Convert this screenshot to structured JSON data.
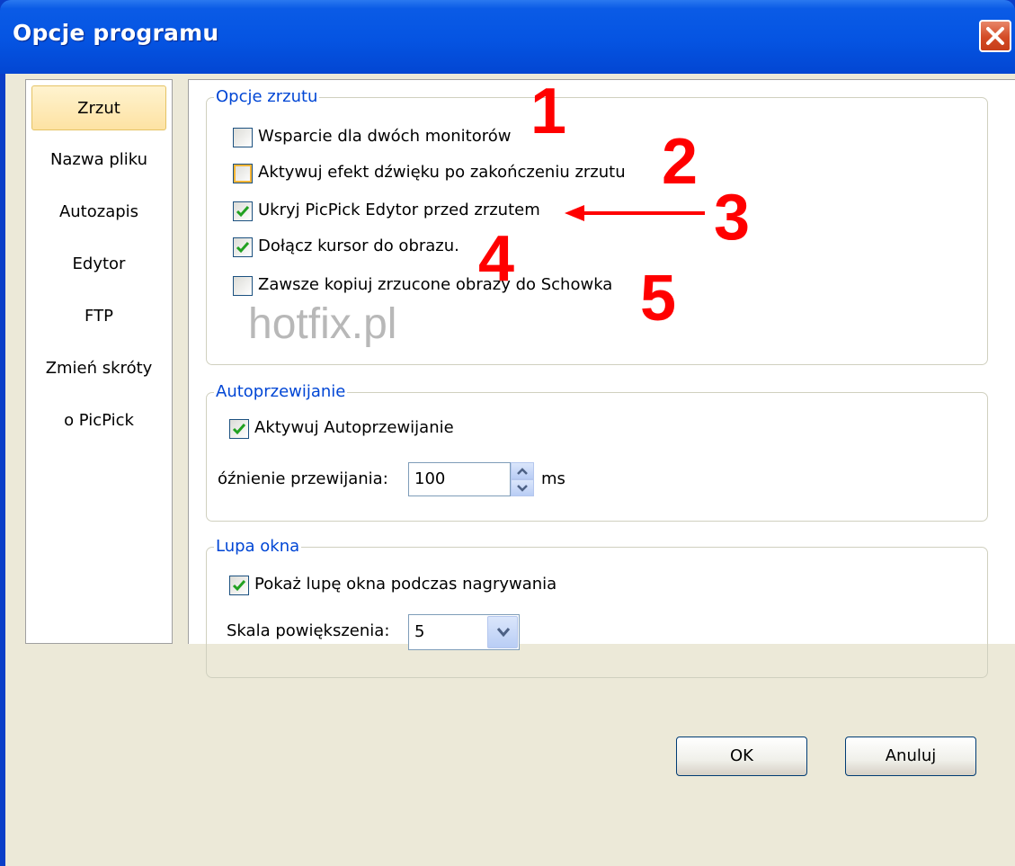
{
  "window": {
    "title": "Opcje programu"
  },
  "nav": {
    "items": [
      {
        "label": "Zrzut",
        "selected": true
      },
      {
        "label": "Nazwa pliku",
        "selected": false
      },
      {
        "label": "Autozapis",
        "selected": false
      },
      {
        "label": "Edytor",
        "selected": false
      },
      {
        "label": "FTP",
        "selected": false
      },
      {
        "label": "Zmień skróty",
        "selected": false
      },
      {
        "label": "o PicPick",
        "selected": false
      }
    ]
  },
  "capture": {
    "legend": "Opcje zrzutu",
    "options": [
      {
        "label": "Wsparcie dla dwóch monitorów",
        "checked": false
      },
      {
        "label": "Aktywuj efekt dźwięku po zakończeniu zrzutu",
        "checked": false
      },
      {
        "label": "Ukryj PicPick Edytor przed zrzutem",
        "checked": true
      },
      {
        "label": "Dołącz kursor do obrazu.",
        "checked": true
      },
      {
        "label": "Zawsze kopiuj zrzucone obrazy do Schowka",
        "checked": false
      }
    ],
    "watermark": "hotfix.pl"
  },
  "annotations": [
    "1",
    "2",
    "3",
    "4",
    "5"
  ],
  "autoscroll": {
    "legend": "Autoprzewijanie",
    "enable_label": "Aktywuj Autoprzewijanie",
    "enable_checked": true,
    "delay_label": "óźnienie przewijania:",
    "delay_value": "100",
    "delay_unit": "ms"
  },
  "magnifier": {
    "legend": "Lupa okna",
    "show_label": "Pokaż lupę okna podczas nagrywania",
    "show_checked": true,
    "scale_label": "Skala powiększenia:",
    "scale_value": "5"
  },
  "buttons": {
    "ok": "OK",
    "cancel": "Anuluj"
  },
  "colors": {
    "title_bar": "#0554e2",
    "legend_text": "#0046d5",
    "annotation": "#ff0000",
    "nav_selected": "#fde2a3"
  }
}
